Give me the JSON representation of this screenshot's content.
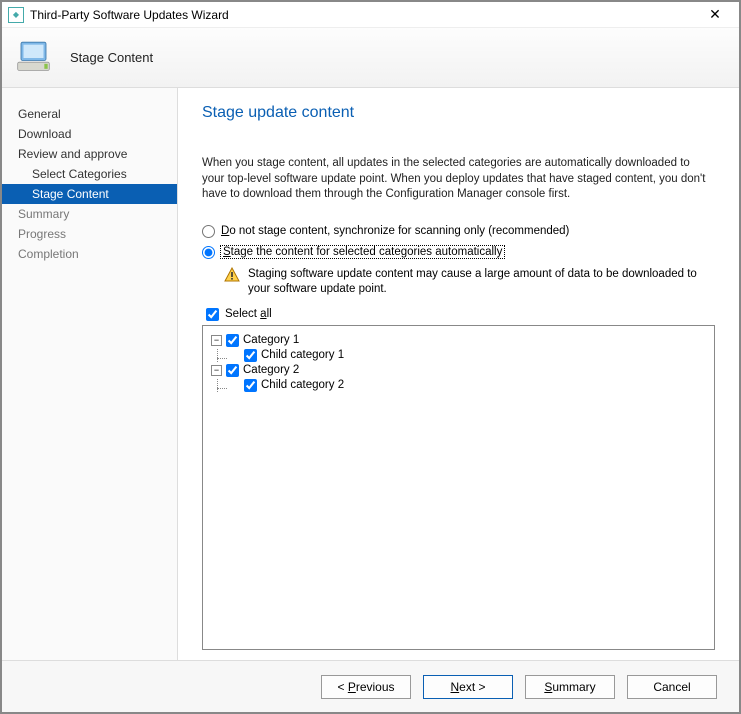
{
  "window": {
    "title": "Third-Party Software Updates Wizard"
  },
  "header": {
    "subtitle": "Stage Content"
  },
  "sidebar": {
    "items": [
      {
        "label": "General",
        "level": 0,
        "state": "normal"
      },
      {
        "label": "Download",
        "level": 0,
        "state": "normal"
      },
      {
        "label": "Review and approve",
        "level": 0,
        "state": "normal"
      },
      {
        "label": "Select Categories",
        "level": 1,
        "state": "normal"
      },
      {
        "label": "Stage Content",
        "level": 1,
        "state": "selected"
      },
      {
        "label": "Summary",
        "level": 0,
        "state": "dim"
      },
      {
        "label": "Progress",
        "level": 0,
        "state": "dim"
      },
      {
        "label": "Completion",
        "level": 0,
        "state": "dim"
      }
    ]
  },
  "main": {
    "title": "Stage update content",
    "intro": "When you stage content, all updates in the selected categories are automatically downloaded to your top-level software update point. When you deploy updates that have staged content, you don't have to download them through the Configuration Manager console first.",
    "option1_prefix": "D",
    "option1_rest": "o not stage content, synchronize for scanning only (recommended)",
    "option2_prefix": "S",
    "option2_rest": "tage the content for selected categories automatically",
    "warning": "Staging software update content may cause a large amount of data to be downloaded to your software update point.",
    "selectall_prefix": "Select ",
    "selectall_ul": "a",
    "selectall_rest": "ll",
    "tree": [
      {
        "label": "Category 1",
        "checked": true,
        "children": [
          {
            "label": "Child category 1",
            "checked": true
          }
        ]
      },
      {
        "label": "Category 2",
        "checked": true,
        "children": [
          {
            "label": "Child category 2",
            "checked": true
          }
        ]
      }
    ]
  },
  "footer": {
    "previous_prefix": "< ",
    "previous_ul": "P",
    "previous_rest": "revious",
    "next_ul": "N",
    "next_rest": "ext >",
    "summary_ul": "S",
    "summary_rest": "ummary",
    "cancel": "Cancel"
  }
}
